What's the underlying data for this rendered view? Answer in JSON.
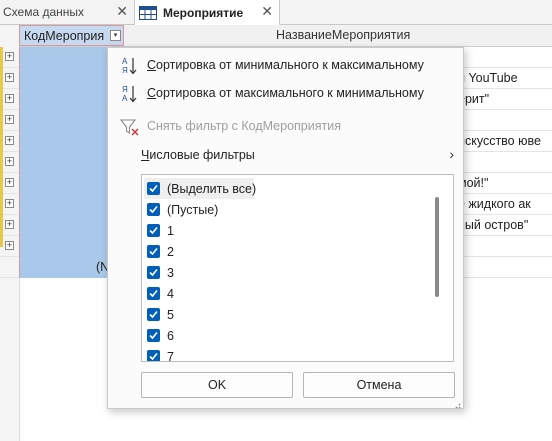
{
  "tabs": [
    {
      "label": "Схема данных",
      "icon": "relationships-icon",
      "close": "✕"
    },
    {
      "label": "Мероприятие",
      "icon": "table-icon",
      "close": "✕"
    }
  ],
  "grid": {
    "columns": [
      "КодМероприя",
      "НазваниеМероприятия"
    ],
    "dropdown_glyph": "▾",
    "expander_glyph": "+",
    "rows_visible_text": [
      "",
      "и YouTube",
      "ерит\"",
      "",
      "искусство юве",
      "",
      "мой!\"",
      "е жидкого ак",
      "ный остров\"",
      "",
      ""
    ],
    "new_row_label": "(N"
  },
  "menu": {
    "sort_asc": "Сортировка от минимального к максимальному",
    "sort_desc": "Сортировка от максимального к минимальному",
    "clear_filter": "Снять фильтр с КодМероприятия",
    "number_filters": "Числовые фильтры",
    "number_filters_chevron": "›",
    "icon_sort_az_top": "А",
    "icon_sort_az_bottom": "Я",
    "icon_sort_za_top": "Я",
    "icon_sort_za_bottom": "А",
    "options": [
      {
        "label": "(Выделить все)",
        "checked": true
      },
      {
        "label": "(Пустые)",
        "checked": true
      },
      {
        "label": "1",
        "checked": true
      },
      {
        "label": "2",
        "checked": true
      },
      {
        "label": "3",
        "checked": true
      },
      {
        "label": "4",
        "checked": true
      },
      {
        "label": "5",
        "checked": true
      },
      {
        "label": "6",
        "checked": true
      },
      {
        "label": "7",
        "checked": true
      }
    ],
    "ok_label": "OK",
    "cancel_label": "Отмена"
  },
  "colors": {
    "selected_column": "#a9c8ea",
    "checkbox": "#005fb8",
    "column_border": "#d79aa0"
  }
}
